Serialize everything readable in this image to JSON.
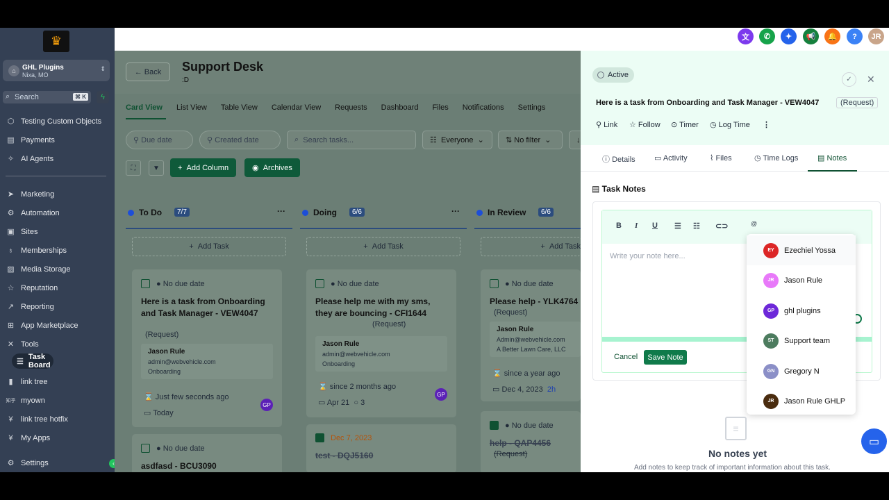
{
  "sidebar": {
    "logo_icon": "crown-logo",
    "account": {
      "name": "GHL Plugins",
      "location": "Nixa, MO"
    },
    "search": {
      "placeholder": "Search",
      "shortcut": "⌘ K"
    },
    "items": [
      {
        "label": "Testing Custom Objects",
        "icon": "cube-icon"
      },
      {
        "label": "Payments",
        "icon": "receipt-icon"
      },
      {
        "label": "AI Agents",
        "icon": "sparkle-icon"
      },
      {
        "label": "Marketing",
        "icon": "send-icon"
      },
      {
        "label": "Automation",
        "icon": "gear-icon"
      },
      {
        "label": "Sites",
        "icon": "globe-icon"
      },
      {
        "label": "Memberships",
        "icon": "award-icon"
      },
      {
        "label": "Media Storage",
        "icon": "image-icon"
      },
      {
        "label": "Reputation",
        "icon": "star-icon"
      },
      {
        "label": "Reporting",
        "icon": "chart-icon"
      },
      {
        "label": "App Marketplace",
        "icon": "grid-icon"
      },
      {
        "label": "Tools",
        "icon": "tools-icon"
      },
      {
        "label": "Task Board",
        "icon": "list-icon"
      },
      {
        "label": "link tree",
        "icon": "link-icon"
      },
      {
        "label": "myown",
        "icon": "text-icon"
      },
      {
        "label": "link tree hotfix",
        "icon": "yen-icon"
      },
      {
        "label": "My Apps",
        "icon": "yen-icon"
      },
      {
        "label": "Settings",
        "icon": "settings-icon"
      }
    ],
    "active_index": 12
  },
  "topbar": {
    "buttons": [
      {
        "icon": "translate-icon",
        "color": "#7c3aed",
        "label": "文"
      },
      {
        "icon": "phone-icon",
        "color": "#16a34a",
        "label": "✆"
      },
      {
        "icon": "magic-icon",
        "color": "#2563eb",
        "label": "✦"
      },
      {
        "icon": "megaphone-icon",
        "color": "#15803d",
        "label": "📢"
      },
      {
        "icon": "bell-icon",
        "color": "#f97316",
        "label": "🔔"
      },
      {
        "icon": "help-icon",
        "color": "#3b82f6",
        "label": "?"
      },
      {
        "icon": "user-avatar",
        "color": "#c9a58a",
        "label": "JR"
      }
    ]
  },
  "board": {
    "back_label": "Back",
    "title": "Support Desk",
    "subtitle": ":D",
    "tabs": [
      "Card View",
      "List View",
      "Table View",
      "Calendar View",
      "Requests",
      "Dashboard",
      "Files",
      "Notifications",
      "Settings"
    ],
    "filters": {
      "due": "Due date",
      "created": "Created date",
      "search_placeholder": "Search tasks...",
      "assignee": "Everyone",
      "filter": "No filter"
    },
    "add_column": "Add Column",
    "archives": "Archives",
    "add_task": "Add Task",
    "columns": [
      {
        "name": "To Do",
        "count": "7/7"
      },
      {
        "name": "Doing",
        "count": "6/6"
      },
      {
        "name": "In Review",
        "count": "6/6"
      }
    ],
    "cards": {
      "c1": {
        "due": "No due date",
        "title": "Here is a task from Onboarding and Task Manager - VEW4047",
        "req": "(Request)",
        "contact": "Jason Rule",
        "email": "admin@webvehicle.com",
        "pipeline": "Onboarding",
        "time": "Just few seconds ago",
        "date": "Today",
        "avatar": "GP"
      },
      "c2": {
        "due": "No due date",
        "title": "Please help me with my sms, they are bouncing - CFI1644",
        "req": "(Request)",
        "contact": "Jason Rule",
        "email": "admin@webvehicle.com",
        "pipeline": "Onboarding",
        "time": "since 2 months ago",
        "date": "Apr 21",
        "comments": "3",
        "avatar": "GP"
      },
      "c3": {
        "due": "No due date",
        "title": "Please help - YLK4764",
        "req": "(Request)",
        "contact": "Jason Rule",
        "email": "Admin@webvehicle.com",
        "pipeline": "A Better Lawn Care, LLC",
        "time": "since a year ago",
        "date": "Dec 4, 2023",
        "badge": "2h"
      },
      "c4": {
        "due": "No due date",
        "title": "asdfasd - BCU3090"
      },
      "c5": {
        "due": "Dec 7, 2023",
        "title": "test - DQJ5160"
      },
      "c6": {
        "due": "No due date",
        "title": "help - QAP4456",
        "req": "(Request)"
      }
    }
  },
  "panel": {
    "status": "Active",
    "title": "Here is a task from Onboarding and Task Manager - VEW4047",
    "request_tag": "(Request)",
    "actions": [
      "Link",
      "Follow",
      "Timer",
      "Log Time"
    ],
    "tabs": [
      "Details",
      "Activity",
      "Files",
      "Time Logs",
      "Notes"
    ],
    "notes_heading": "Task Notes",
    "editor_placeholder": "Write your note here...",
    "cancel": "Cancel",
    "save": "Save Note",
    "mention_symbol": "@",
    "mentions": [
      {
        "initials": "EY",
        "name": "Ezechiel Yossa",
        "color": "#dc2626"
      },
      {
        "initials": "JR",
        "name": "Jason Rule",
        "color": "#e879f9"
      },
      {
        "initials": "GP",
        "name": "ghl plugins",
        "color": "#6d28d9"
      },
      {
        "initials": "ST",
        "name": "Support team",
        "color": "#4d7c5f"
      },
      {
        "initials": "GN",
        "name": "Gregory N",
        "color": "#8b8fc7"
      },
      {
        "initials": "JR",
        "name": "Jason Rule GHLP",
        "color": "#4a2c0f"
      }
    ],
    "empty_title": "No notes yet",
    "empty_sub": "Add notes to keep track of important information about this task."
  }
}
